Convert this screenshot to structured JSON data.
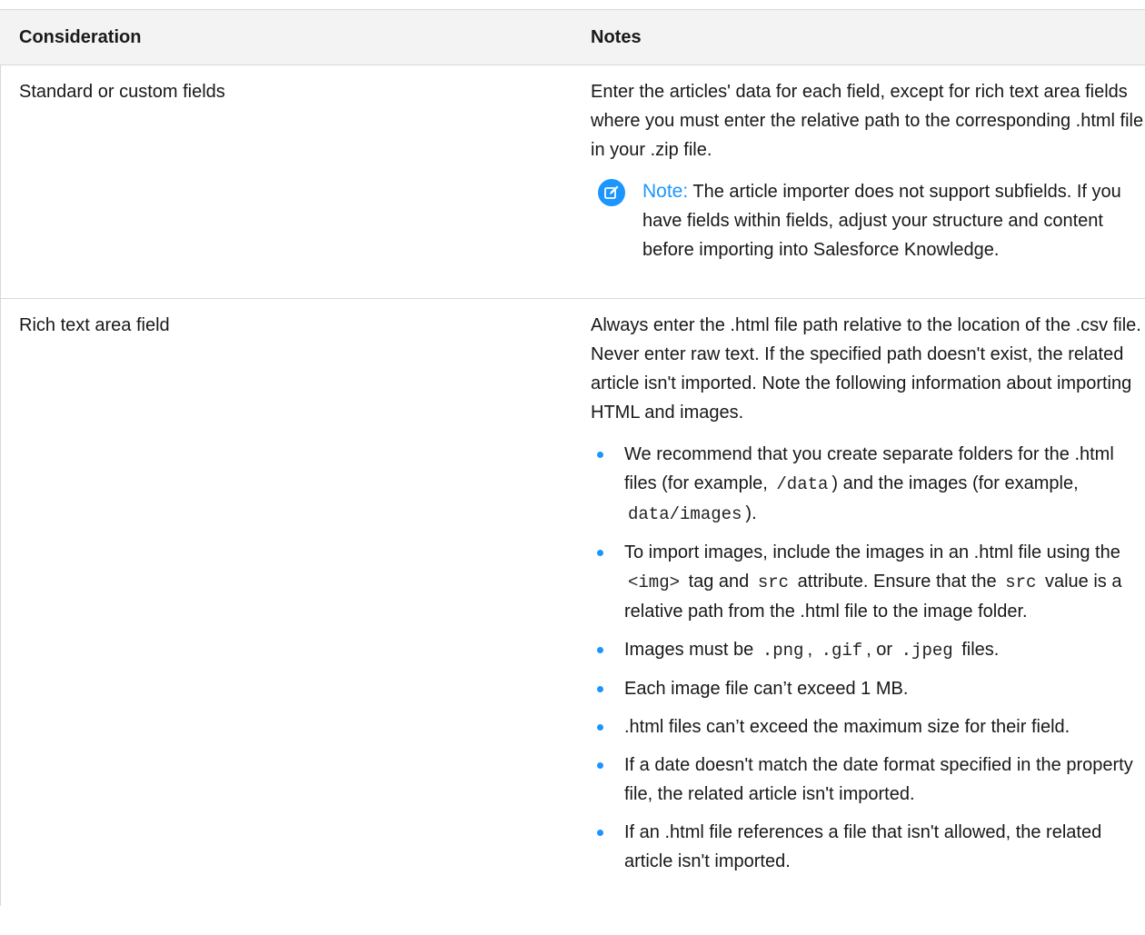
{
  "table": {
    "headers": {
      "consideration": "Consideration",
      "notes": "Notes"
    },
    "rows": [
      {
        "consideration": "Standard or custom fields",
        "notes_text": "Enter the articles' data for each field, except for rich text area fields where you must enter the relative path to the corresponding .html file in your .zip file.",
        "note_label": "Note:",
        "note_text": "The article importer does not support subfields. If you have fields within fields, adjust your structure and content before importing into Salesforce Knowledge."
      },
      {
        "consideration": "Rich text area field",
        "notes_text": "Always enter the .html file path relative to the location of the .csv file. Never enter raw text. If the specified path doesn't exist, the related article isn't imported. Note the following information about importing HTML and images.",
        "bullets": {
          "b1": {
            "t1": "We recommend that you create separate folders for the .html files (for example, ",
            "c1": "/data",
            "t2": ") and the images (for example, ",
            "c2": "data/images",
            "t3": ")."
          },
          "b2": {
            "t1": "To import images, include the images in an .html file using the ",
            "c1": "<img>",
            "t2": " tag and ",
            "c2": "src",
            "t3": " attribute. Ensure that the ",
            "c3": "src",
            "t4": " value is a relative path from the .html file to the image folder."
          },
          "b3": {
            "t1": "Images must be ",
            "c1": ".png",
            "t2": ", ",
            "c2": ".gif",
            "t3": ", or ",
            "c3": ".jpeg",
            "t4": " files."
          },
          "b4": "Each image file can’t exceed 1 MB.",
          "b5": ".html files can’t exceed the maximum size for their field.",
          "b6": "If a date doesn't match the date format specified in the property file, the related article isn't imported.",
          "b7": "If an .html file references a file that isn't allowed, the related article isn't imported."
        }
      }
    ]
  },
  "colors": {
    "accent": "#1b96ff",
    "header_bg": "#f3f3f3",
    "border": "#d9d9d9"
  },
  "icons": {
    "note": "edit-note-icon"
  }
}
